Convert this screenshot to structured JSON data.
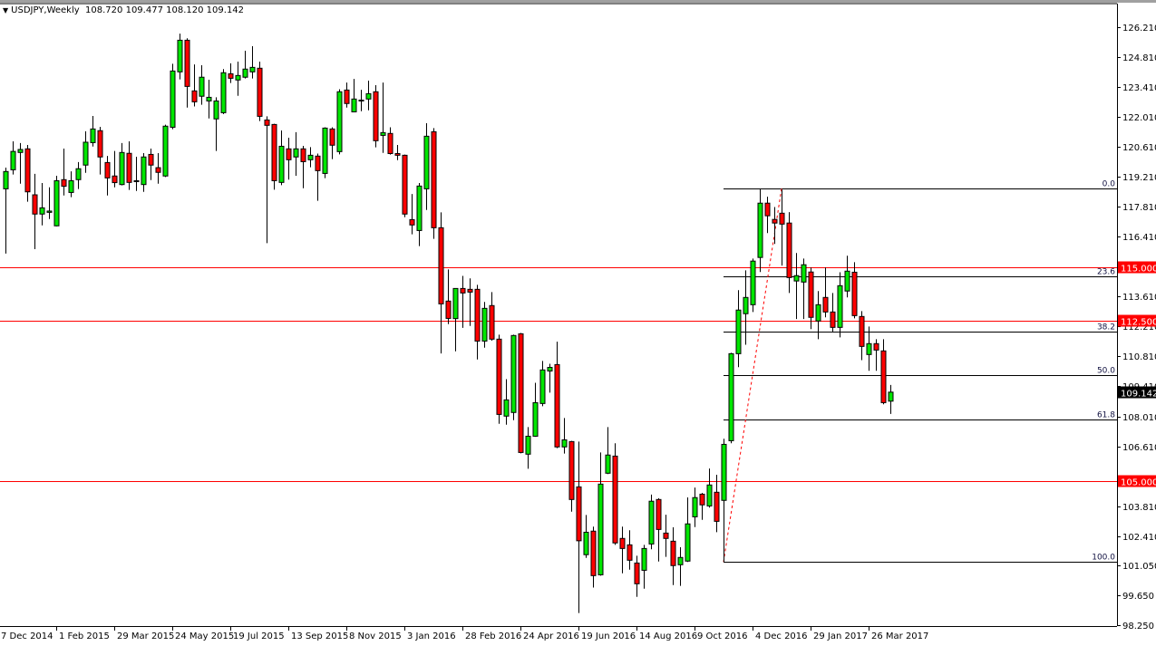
{
  "header": {
    "symbol": "USDJPY,Weekly",
    "open": "108.720",
    "high": "109.477",
    "low": "108.120",
    "close": "109.142",
    "menu_icon": "triangle-down-icon"
  },
  "colors": {
    "bull": "#00e600",
    "bear": "#ff0000",
    "line_red": "#ff0000",
    "fib": "#000000",
    "background": "#ffffff"
  },
  "chart_data": {
    "type": "candlestick",
    "title": "USDJPY,Weekly",
    "ylim": [
      98.25,
      126.21
    ],
    "grid": false,
    "price_axis_labels": [
      "126.210",
      "124.810",
      "123.410",
      "122.010",
      "120.610",
      "119.210",
      "117.810",
      "116.410",
      "113.610",
      "112.210",
      "110.810",
      "109.410",
      "108.010",
      "106.610",
      "103.810",
      "102.410",
      "101.050",
      "99.650",
      "98.250"
    ],
    "date_labels": [
      "7 Dec 2014",
      "1 Feb 2015",
      "29 Mar 2015",
      "24 May 2015",
      "19 Jul 2015",
      "13 Sep 2015",
      "8 Nov 2015",
      "3 Jan 2016",
      "28 Feb 2016",
      "24 Apr 2016",
      "19 Jun 2016",
      "14 Aug 2016",
      "9 Oct 2016",
      "4 Dec 2016",
      "29 Jan 2017",
      "26 Mar 2017"
    ],
    "date_label_interval_weeks": 8,
    "candles_ohlc": [
      [
        118.65,
        119.64,
        115.62,
        119.46
      ],
      [
        119.54,
        120.87,
        119.32,
        120.4
      ],
      [
        120.35,
        120.79,
        118.89,
        120.49
      ],
      [
        120.52,
        120.7,
        118.05,
        118.51
      ],
      [
        118.37,
        119.35,
        115.83,
        117.47
      ],
      [
        117.47,
        118.92,
        116.94,
        117.76
      ],
      [
        117.55,
        118.72,
        117.24,
        117.61
      ],
      [
        116.92,
        119.26,
        116.9,
        119.03
      ],
      [
        119.08,
        120.53,
        118.34,
        118.77
      ],
      [
        118.48,
        119.47,
        118.26,
        119.03
      ],
      [
        119.08,
        119.9,
        118.64,
        119.59
      ],
      [
        119.76,
        121.34,
        119.4,
        120.83
      ],
      [
        120.81,
        122.06,
        120.63,
        121.45
      ],
      [
        121.37,
        121.55,
        119.32,
        120.14
      ],
      [
        119.88,
        120.19,
        118.34,
        119.16
      ],
      [
        119.25,
        120.42,
        118.72,
        118.94
      ],
      [
        118.85,
        120.79,
        118.81,
        120.35
      ],
      [
        120.31,
        120.87,
        118.6,
        118.95
      ],
      [
        119.03,
        120.15,
        118.55,
        119.02
      ],
      [
        118.85,
        120.32,
        118.51,
        120.14
      ],
      [
        120.26,
        120.53,
        119.06,
        119.76
      ],
      [
        119.64,
        120.32,
        118.89,
        119.42
      ],
      [
        119.25,
        121.65,
        119.2,
        121.58
      ],
      [
        121.53,
        124.5,
        121.44,
        124.16
      ],
      [
        124.12,
        125.91,
        123.77,
        125.6
      ],
      [
        125.6,
        125.69,
        122.45,
        123.44
      ],
      [
        123.23,
        124.47,
        122.5,
        122.72
      ],
      [
        122.98,
        124.43,
        122.58,
        123.87
      ],
      [
        122.76,
        123.75,
        121.94,
        122.93
      ],
      [
        121.92,
        122.93,
        120.42,
        122.76
      ],
      [
        122.21,
        124.25,
        122.15,
        124.08
      ],
      [
        124.03,
        124.52,
        123.6,
        123.82
      ],
      [
        123.74,
        124.6,
        123.0,
        123.95
      ],
      [
        123.87,
        125.11,
        123.81,
        124.25
      ],
      [
        124.12,
        125.32,
        123.81,
        124.33
      ],
      [
        124.29,
        124.6,
        121.82,
        122.04
      ],
      [
        121.87,
        122.04,
        116.11,
        121.62
      ],
      [
        121.66,
        121.69,
        118.61,
        119.03
      ],
      [
        118.95,
        121.38,
        118.82,
        120.64
      ],
      [
        120.52,
        121.04,
        119.08,
        120.01
      ],
      [
        120.14,
        121.3,
        119.26,
        120.52
      ],
      [
        120.52,
        120.66,
        118.68,
        119.92
      ],
      [
        120.01,
        120.6,
        119.66,
        120.22
      ],
      [
        120.18,
        120.3,
        118.09,
        119.5
      ],
      [
        119.37,
        121.53,
        119.15,
        121.49
      ],
      [
        121.45,
        121.53,
        120.04,
        120.69
      ],
      [
        120.39,
        123.31,
        120.26,
        123.19
      ],
      [
        123.27,
        123.62,
        122.45,
        122.64
      ],
      [
        122.25,
        123.79,
        122.25,
        122.85
      ],
      [
        122.79,
        123.28,
        122.28,
        122.8
      ],
      [
        122.85,
        123.71,
        122.32,
        123.1
      ],
      [
        123.19,
        123.5,
        120.59,
        120.9
      ],
      [
        121.15,
        123.62,
        120.33,
        121.28
      ],
      [
        121.24,
        121.53,
        120.25,
        120.3
      ],
      [
        120.3,
        120.7,
        119.99,
        120.22
      ],
      [
        120.22,
        120.25,
        117.32,
        117.47
      ],
      [
        117.21,
        118.41,
        116.52,
        116.96
      ],
      [
        116.7,
        118.92,
        115.97,
        118.78
      ],
      [
        118.65,
        121.72,
        117.66,
        121.11
      ],
      [
        121.32,
        121.49,
        116.31,
        116.83
      ],
      [
        116.83,
        117.55,
        110.95,
        113.27
      ],
      [
        113.4,
        114.88,
        112.32,
        112.59
      ],
      [
        112.58,
        113.99,
        111.05,
        113.99
      ],
      [
        113.99,
        114.58,
        112.15,
        113.78
      ],
      [
        113.95,
        114.46,
        112.24,
        113.82
      ],
      [
        113.95,
        114.16,
        110.67,
        111.53
      ],
      [
        111.53,
        113.36,
        111.22,
        113.06
      ],
      [
        113.19,
        113.82,
        111.55,
        111.62
      ],
      [
        111.62,
        111.83,
        107.66,
        108.1
      ],
      [
        108.02,
        109.75,
        107.62,
        108.78
      ],
      [
        108.19,
        111.83,
        107.83,
        111.79
      ],
      [
        111.87,
        111.91,
        106.28,
        106.32
      ],
      [
        106.24,
        107.51,
        105.56,
        107.08
      ],
      [
        107.08,
        109.58,
        107.05,
        108.65
      ],
      [
        108.61,
        110.6,
        108.48,
        110.18
      ],
      [
        110.13,
        110.47,
        109.12,
        110.3
      ],
      [
        110.43,
        111.5,
        106.52,
        106.58
      ],
      [
        106.58,
        107.93,
        106.27,
        106.91
      ],
      [
        106.83,
        106.86,
        103.55,
        104.12
      ],
      [
        104.71,
        106.83,
        98.81,
        102.19
      ],
      [
        101.54,
        103.4,
        101.39,
        102.59
      ],
      [
        102.64,
        102.85,
        100.0,
        100.56
      ],
      [
        100.6,
        106.32,
        100.56,
        104.84
      ],
      [
        105.35,
        107.51,
        105.31,
        106.2
      ],
      [
        106.15,
        106.75,
        102.0,
        102.09
      ],
      [
        102.3,
        102.85,
        100.67,
        101.83
      ],
      [
        102.0,
        102.68,
        100.84,
        101.28
      ],
      [
        101.15,
        101.49,
        99.57,
        100.18
      ],
      [
        100.81,
        102.0,
        99.95,
        101.83
      ],
      [
        102.04,
        104.35,
        101.79,
        104.04
      ],
      [
        104.12,
        104.18,
        101.22,
        102.72
      ],
      [
        102.55,
        103.41,
        101.44,
        102.3
      ],
      [
        102.17,
        102.82,
        100.12,
        101.03
      ],
      [
        101.07,
        101.89,
        100.08,
        101.41
      ],
      [
        101.24,
        104.22,
        101.2,
        102.98
      ],
      [
        103.31,
        104.68,
        102.83,
        104.21
      ],
      [
        104.37,
        104.43,
        103.17,
        103.87
      ],
      [
        103.82,
        105.57,
        103.74,
        104.8
      ],
      [
        104.46,
        105.28,
        102.59,
        103.1
      ],
      [
        104.08,
        106.96,
        101.2,
        106.7
      ],
      [
        106.87,
        110.98,
        106.75,
        110.94
      ],
      [
        110.94,
        113.91,
        110.31,
        112.98
      ],
      [
        112.81,
        114.84,
        111.36,
        113.57
      ],
      [
        113.23,
        115.39,
        112.89,
        115.27
      ],
      [
        115.44,
        118.66,
        114.76,
        117.98
      ],
      [
        117.98,
        118.28,
        116.58,
        117.39
      ],
      [
        117.22,
        117.8,
        116.07,
        117.05
      ],
      [
        117.51,
        118.61,
        115.06,
        117.0
      ],
      [
        117.05,
        117.56,
        113.78,
        114.5
      ],
      [
        114.34,
        115.65,
        112.56,
        114.59
      ],
      [
        114.29,
        115.39,
        112.56,
        115.1
      ],
      [
        114.76,
        114.97,
        112.09,
        112.64
      ],
      [
        112.47,
        113.87,
        111.62,
        113.23
      ],
      [
        113.57,
        114.97,
        112.64,
        112.89
      ],
      [
        112.89,
        113.78,
        111.96,
        112.17
      ],
      [
        112.17,
        114.75,
        111.7,
        114.12
      ],
      [
        113.87,
        115.52,
        113.57,
        114.8
      ],
      [
        114.75,
        115.22,
        112.59,
        112.72
      ],
      [
        112.68,
        112.93,
        110.64,
        111.28
      ],
      [
        110.9,
        112.21,
        110.14,
        111.41
      ],
      [
        111.41,
        111.62,
        110.14,
        111.11
      ],
      [
        111.07,
        111.62,
        108.57,
        108.65
      ],
      [
        108.72,
        109.477,
        108.12,
        109.142
      ]
    ],
    "horizontal_lines": [
      {
        "price": 115.0,
        "label": "115.000"
      },
      {
        "price": 112.5,
        "label": "112.500"
      },
      {
        "price": 105.0,
        "label": "105.000"
      }
    ],
    "current_price": {
      "price": 109.142,
      "label": "109.142"
    },
    "fibonacci": {
      "high": 118.66,
      "low": 101.2,
      "start_candle": 99,
      "end_candle": 107,
      "levels": [
        {
          "ratio": 0.0,
          "label": "0.0"
        },
        {
          "ratio": 0.236,
          "label": "23.6"
        },
        {
          "ratio": 0.382,
          "label": "38.2"
        },
        {
          "ratio": 0.5,
          "label": "50.0"
        },
        {
          "ratio": 0.618,
          "label": "61.8"
        },
        {
          "ratio": 1.0,
          "label": "100.0"
        }
      ]
    }
  }
}
